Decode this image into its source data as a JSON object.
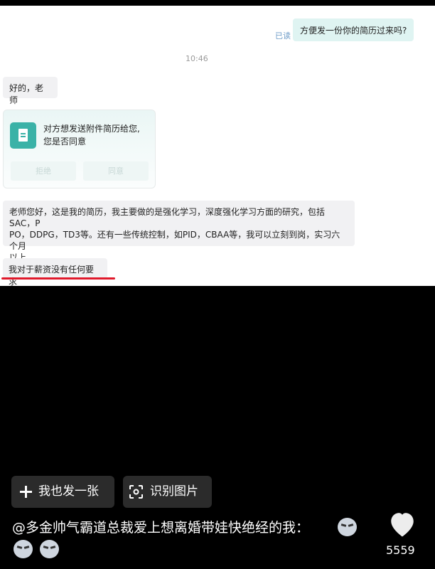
{
  "chat": {
    "read_status": "已读",
    "outgoing_message": "方便发一份你的简历过来吗?",
    "time": "10:46",
    "reply_1": "好的，老师",
    "attachment_card": {
      "text_line1": "对方想发送附件简历给您,",
      "text_line2": "您是否同意",
      "reject_label": "拒绝",
      "agree_label": "同意"
    },
    "reply_2_line1": "老师您好，这是我的简历，我主要做的是强化学习，深度强化学习方面的研究，包括SAC，P",
    "reply_2_line2": "PO，DDPG，TD3等。还有一些传统控制，如PID，CBAA等，我可以立刻到岗，实习六个月",
    "reply_2_line3": "以上",
    "reply_3": "我对于薪资没有任何要求"
  },
  "actions": {
    "post_label": "我也发一张",
    "recognize_label": "识别图片"
  },
  "post": {
    "caption": "@多金帅气霸道总裁爱上想离婚带娃快绝经的我：",
    "like_count": "5559"
  },
  "colors": {
    "accent": "#3ab2a7",
    "outgoing_bubble": "#dff4f2",
    "incoming_bubble": "#f1f1f3",
    "highlight_underline": "#e0192b",
    "read_status": "#6e9cc8"
  },
  "icons": [
    "document-icon",
    "plus-icon",
    "scan-icon",
    "heart-icon",
    "cat-emoji"
  ]
}
